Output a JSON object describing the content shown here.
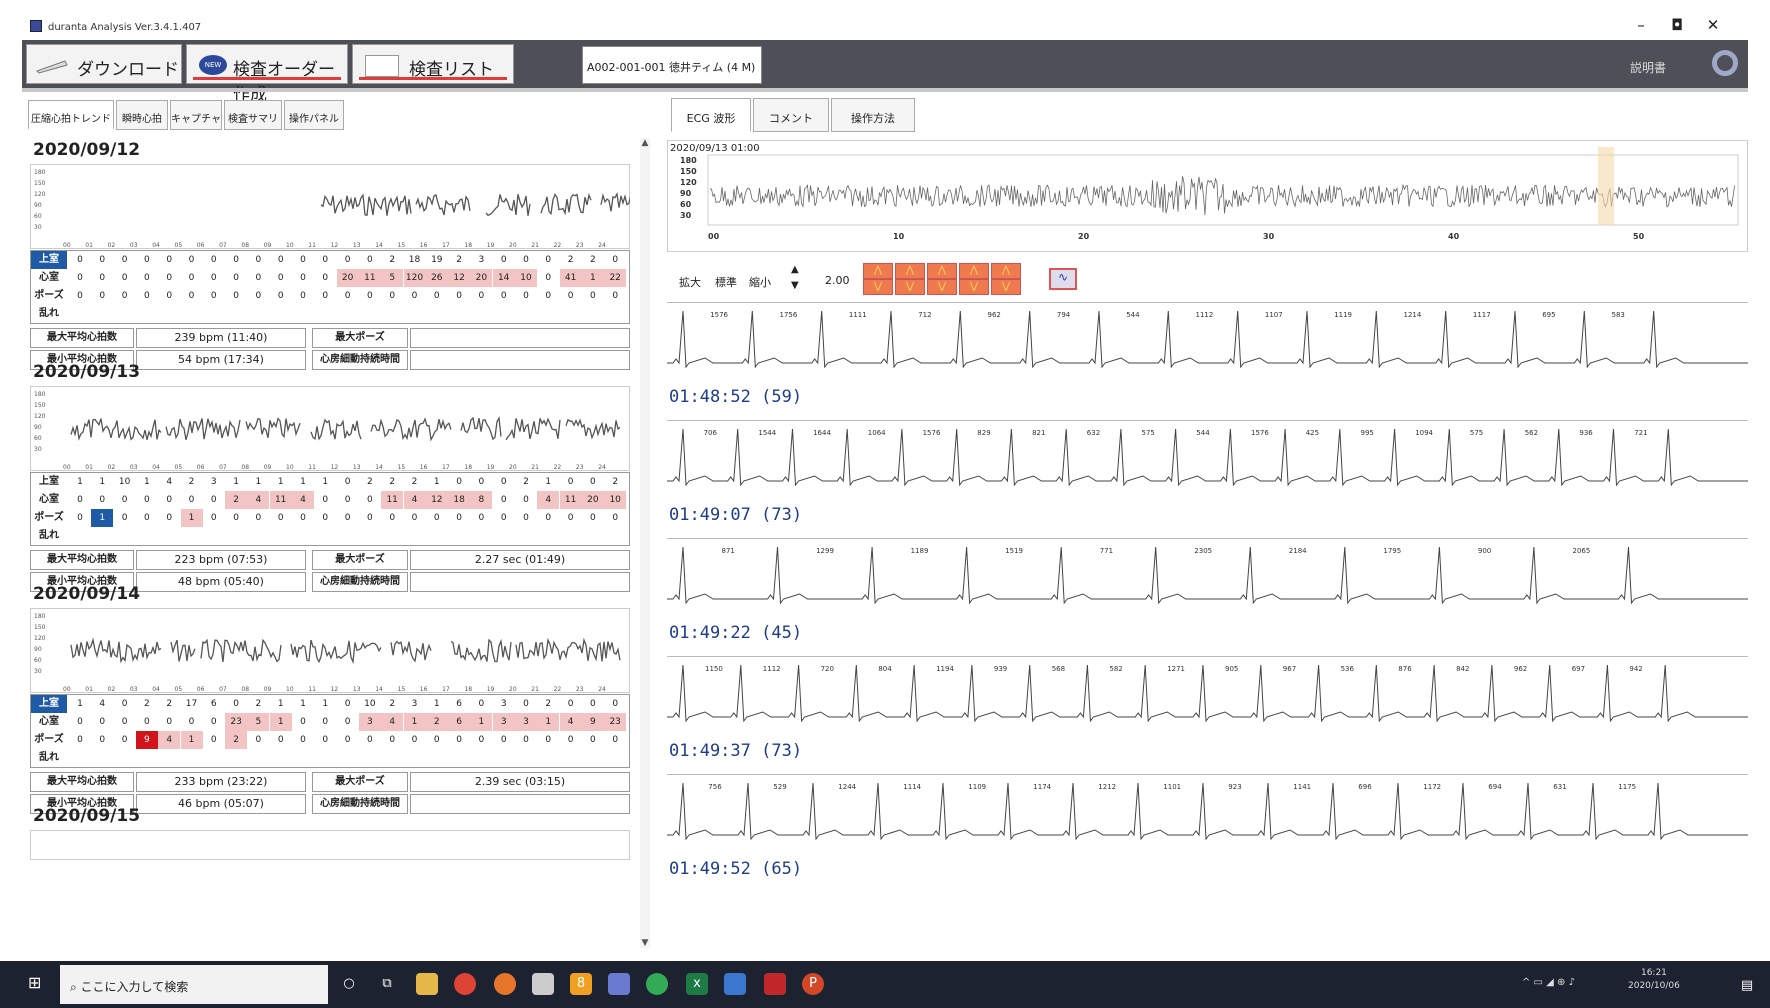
{
  "window": {
    "title": "duranta Analysis Ver.3.4.1.407",
    "minimize": "–",
    "maximize": "◘",
    "close": "✕"
  },
  "toolbar": {
    "tabs": [
      {
        "label": "ダウンロード",
        "icon": "download-icon"
      },
      {
        "label": "検査オーダー作成",
        "badge": "NEW"
      },
      {
        "label": "検査リスト"
      }
    ],
    "patient": "A002-001-001 徳井ティム (4 M)",
    "manual": "説明書",
    "accent": "#e03a3a",
    "dark": "#4e4f57"
  },
  "left_tabs": [
    "圧縮心拍トレンド",
    "瞬時心拍",
    "キャプチャ",
    "検査サマリ",
    "操作パネル"
  ],
  "right_tabs": [
    "ECG 波形",
    "コメント",
    "操作方法"
  ],
  "hour_labels": [
    "00",
    "01",
    "02",
    "03",
    "04",
    "05",
    "06",
    "07",
    "08",
    "09",
    "10",
    "11",
    "12",
    "13",
    "14",
    "15",
    "16",
    "17",
    "18",
    "19",
    "20",
    "21",
    "22",
    "23",
    "24"
  ],
  "row_labels": [
    "上室",
    "心室",
    "ポーズ",
    "乱れ"
  ],
  "trend_ylabels": [
    "180",
    "150",
    "120",
    "90",
    "60",
    "30"
  ],
  "summary_labels": {
    "max_avg": "最大平均心拍数",
    "min_avg": "最小平均心拍数",
    "max_pause": "最大ポーズ",
    "af_time": "心房細動持続時間"
  },
  "days": [
    {
      "date": "2020/09/12",
      "rows": [
        [
          "0",
          "0",
          "0",
          "0",
          "0",
          "0",
          "0",
          "0",
          "0",
          "0",
          "0",
          "0",
          "0",
          "0",
          "2",
          "18",
          "19",
          "2",
          "3",
          "0",
          "0",
          "0",
          "2",
          "2",
          "0"
        ],
        [
          "0",
          "0",
          "0",
          "0",
          "0",
          "0",
          "0",
          "0",
          "0",
          "0",
          "0",
          "0",
          "20",
          "11",
          "5",
          "120",
          "26",
          "12",
          "20",
          "14",
          "10",
          "0",
          "41",
          "1",
          "22"
        ],
        [
          "0",
          "0",
          "0",
          "0",
          "0",
          "0",
          "0",
          "0",
          "0",
          "0",
          "0",
          "0",
          "0",
          "0",
          "0",
          "0",
          "0",
          "0",
          "0",
          "0",
          "0",
          "0",
          "0",
          "0",
          "0"
        ],
        [
          "",
          "",
          "",
          "",
          "",
          "",
          "",
          "",
          "",
          "",
          "",
          "",
          "",
          "",
          "",
          "",
          "",
          "",
          "",
          "",
          "",
          "",
          "",
          "",
          ""
        ]
      ],
      "highlight_ventricular_from": 12,
      "max_avg": "239 bpm (11:40)",
      "min_avg": "54 bpm (17:34)",
      "max_pause": "",
      "af_time": ""
    },
    {
      "date": "2020/09/13",
      "rows": [
        [
          "1",
          "1",
          "10",
          "1",
          "4",
          "2",
          "3",
          "1",
          "1",
          "1",
          "1",
          "1",
          "0",
          "2",
          "2",
          "2",
          "1",
          "0",
          "0",
          "0",
          "2",
          "1",
          "0",
          "0",
          "2"
        ],
        [
          "0",
          "0",
          "0",
          "0",
          "0",
          "0",
          "0",
          "2",
          "4",
          "11",
          "4",
          "0",
          "0",
          "0",
          "11",
          "4",
          "12",
          "18",
          "8",
          "0",
          "0",
          "4",
          "11",
          "20",
          "10"
        ],
        [
          "0",
          "1",
          "0",
          "0",
          "0",
          "1",
          "0",
          "0",
          "0",
          "0",
          "0",
          "0",
          "0",
          "0",
          "0",
          "0",
          "0",
          "0",
          "0",
          "0",
          "0",
          "0",
          "0",
          "0",
          "0"
        ],
        [
          "",
          "",
          "",
          "",
          "",
          "",
          "",
          "",
          "",
          "",
          "",
          "",
          "",
          "",
          "",
          "",
          "",
          "",
          "",
          "",
          "",
          "",
          "",
          "",
          ""
        ]
      ],
      "max_avg": "223 bpm (07:53)",
      "min_avg": "48 bpm (05:40)",
      "max_pause": "2.27 sec (01:49)",
      "af_time": ""
    },
    {
      "date": "2020/09/14",
      "rows": [
        [
          "1",
          "4",
          "0",
          "2",
          "2",
          "17",
          "6",
          "0",
          "2",
          "1",
          "1",
          "1",
          "0",
          "10",
          "2",
          "3",
          "1",
          "6",
          "0",
          "3",
          "0",
          "2",
          "0",
          "0",
          "0"
        ],
        [
          "0",
          "0",
          "0",
          "0",
          "0",
          "0",
          "0",
          "23",
          "5",
          "1",
          "0",
          "0",
          "0",
          "3",
          "4",
          "1",
          "2",
          "6",
          "1",
          "3",
          "3",
          "1",
          "4",
          "9",
          "23"
        ],
        [
          "0",
          "0",
          "0",
          "9",
          "4",
          "1",
          "0",
          "2",
          "0",
          "0",
          "0",
          "0",
          "0",
          "0",
          "0",
          "0",
          "0",
          "0",
          "0",
          "0",
          "0",
          "0",
          "0",
          "0",
          "0"
        ],
        [
          "",
          "",
          "",
          "",
          "",
          "",
          "",
          "",
          "",
          "",
          "",
          "",
          "",
          "",
          "",
          "",
          "",
          "",
          "",
          "",
          "",
          "",
          "",
          "",
          ""
        ]
      ],
      "max_avg": "233 bpm (23:22)",
      "min_avg": "46 bpm (05:07)",
      "max_pause": "2.39 sec (03:15)",
      "af_time": ""
    },
    {
      "date": "2020/09/15"
    }
  ],
  "overview": {
    "datetime": "2020/09/13 01:00",
    "y_labels": [
      "180",
      "150",
      "120",
      "90",
      "60",
      "30"
    ],
    "x_labels": [
      "00",
      "10",
      "20",
      "30",
      "40",
      "50"
    ]
  },
  "controls": {
    "expand": "拡大",
    "standard": "標準",
    "shrink": "縮小",
    "scale": "2.00",
    "up": "▲",
    "down": "▼"
  },
  "strips": [
    {
      "time": "01:48:52 (59)",
      "intervals": [
        "1576",
        "1756",
        "1111",
        "712",
        "962",
        "794",
        "544",
        "1112",
        "1107",
        "1119",
        "1214",
        "1117",
        "695",
        "583"
      ]
    },
    {
      "time": "01:49:07 (73)",
      "intervals": [
        "706",
        "1544",
        "1644",
        "1064",
        "1576",
        "829",
        "821",
        "632",
        "575",
        "544",
        "1576",
        "425",
        "995",
        "1094",
        "575",
        "562",
        "936",
        "721"
      ]
    },
    {
      "time": "01:49:22 (45)",
      "intervals": [
        "871",
        "1299",
        "1189",
        "1519",
        "771",
        "2305",
        "2184",
        "1795",
        "900",
        "2065"
      ]
    },
    {
      "time": "01:49:37 (73)",
      "intervals": [
        "1150",
        "1112",
        "720",
        "804",
        "1194",
        "939",
        "568",
        "582",
        "1271",
        "905",
        "967",
        "536",
        "876",
        "842",
        "962",
        "697",
        "942"
      ]
    },
    {
      "time": "01:49:52 (65)",
      "intervals": [
        "756",
        "529",
        "1244",
        "1114",
        "1109",
        "1174",
        "1212",
        "1101",
        "923",
        "1141",
        "696",
        "1172",
        "694",
        "631",
        "1175"
      ]
    }
  ],
  "taskbar": {
    "search_placeholder": "ここに入力して検索",
    "clock_time": "16:21",
    "clock_date": "2020/10/06"
  }
}
